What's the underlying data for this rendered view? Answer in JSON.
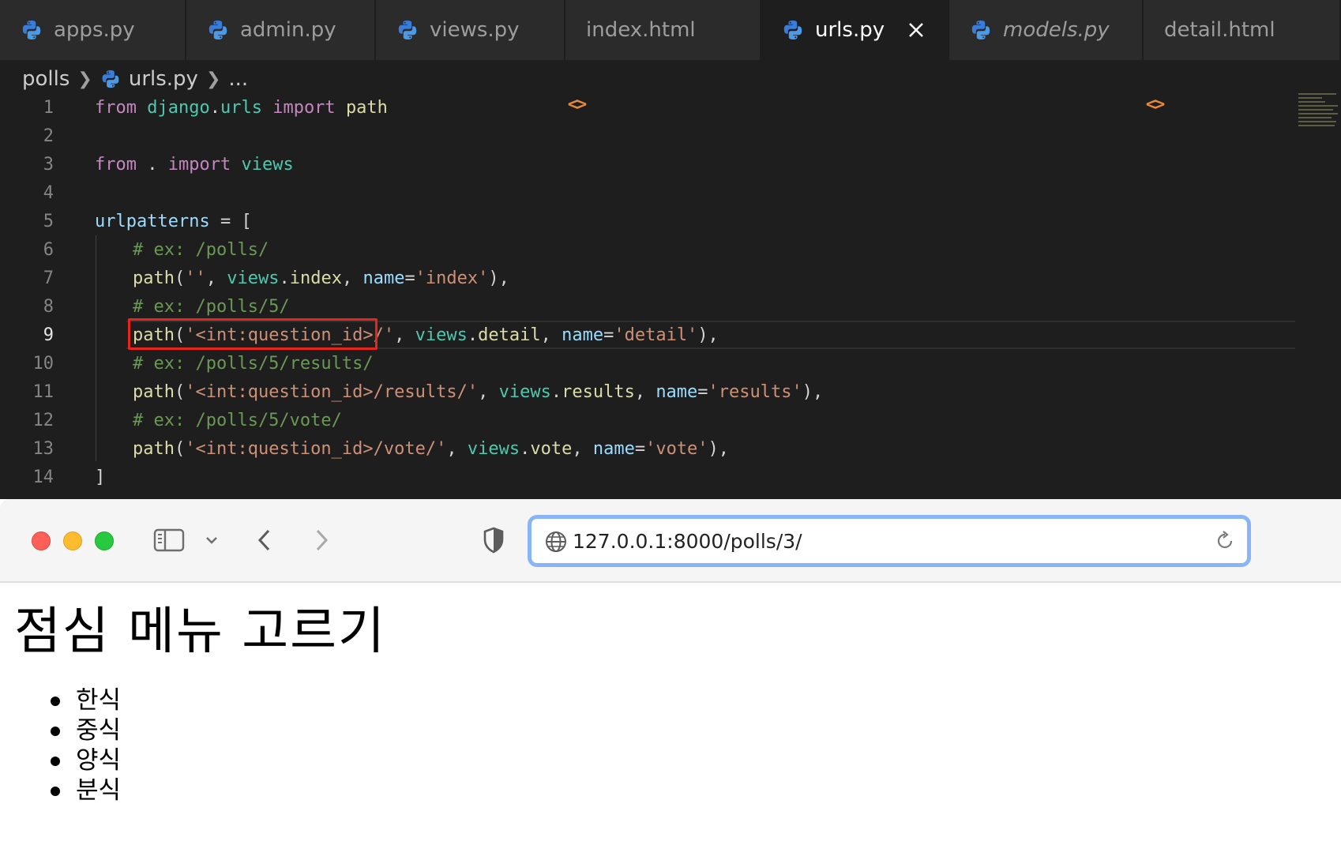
{
  "editor": {
    "tabs": [
      {
        "label": "apps.py",
        "type": "python",
        "active": false,
        "italic": false
      },
      {
        "label": "admin.py",
        "type": "python",
        "active": false,
        "italic": false
      },
      {
        "label": "views.py",
        "type": "python",
        "active": false,
        "italic": false
      },
      {
        "label": "index.html",
        "type": "html",
        "active": false,
        "italic": false
      },
      {
        "label": "urls.py",
        "type": "python",
        "active": true,
        "italic": false
      },
      {
        "label": "models.py",
        "type": "python",
        "active": false,
        "italic": true
      },
      {
        "label": "detail.html",
        "type": "html",
        "active": false,
        "italic": false
      }
    ],
    "breadcrumb": {
      "folder": "polls",
      "file": "urls.py",
      "more": "..."
    },
    "line_numbers": [
      "1",
      "2",
      "3",
      "4",
      "5",
      "6",
      "7",
      "8",
      "9",
      "10",
      "11",
      "12",
      "13",
      "14"
    ],
    "current_line": "9",
    "code": {
      "l1": {
        "from": "from",
        "module1": "django",
        "dot": ".",
        "module2": "urls",
        "import": "import",
        "name": "path"
      },
      "l3": {
        "from": "from",
        "dot": ".",
        "import": "import",
        "name": "views"
      },
      "l5": {
        "var": "urlpatterns",
        "rest": " = ["
      },
      "l6": "# ex: /polls/",
      "l7": {
        "fn": "path",
        "open": "(",
        "str": "''",
        "comma": ", ",
        "mod": "views",
        "dot": ".",
        "attr": "index",
        "comma2": ", ",
        "kw": "name",
        "eq": "=",
        "str2": "'index'",
        "close": "),"
      },
      "l8": "# ex: /polls/5/",
      "l9": {
        "fn": "path",
        "open": "(",
        "str": "'<int:question_id>/'",
        "comma": ", ",
        "mod": "views",
        "dot": ".",
        "attr": "detail",
        "comma2": ", ",
        "kw": "name",
        "eq": "=",
        "str2": "'detail'",
        "close": "),"
      },
      "l10": "# ex: /polls/5/results/",
      "l11": {
        "fn": "path",
        "open": "(",
        "str": "'<int:question_id>/results/'",
        "comma": ", ",
        "mod": "views",
        "dot": ".",
        "attr": "results",
        "comma2": ", ",
        "kw": "name",
        "eq": "=",
        "str2": "'results'",
        "close": "),"
      },
      "l12": "# ex: /polls/5/vote/",
      "l13": {
        "fn": "path",
        "open": "(",
        "str": "'<int:question_id>/vote/'",
        "comma": ", ",
        "mod": "views",
        "dot": ".",
        "attr": "vote",
        "comma2": ", ",
        "kw": "name",
        "eq": "=",
        "str2": "'vote'",
        "close": "),"
      },
      "l14": "]"
    },
    "highlight_color": "#e8251b"
  },
  "browser": {
    "url": "127.0.0.1:8000/polls/3/",
    "page": {
      "heading": "점심 메뉴 고르기",
      "choices": [
        "한식",
        "중식",
        "양식",
        "분식"
      ]
    },
    "url_focus_color": "#8ab4f8"
  },
  "icons": {
    "python_tab": "python-icon",
    "html_tab": "code-brackets-icon",
    "close": "close-icon",
    "sidebar": "sidebar-icon",
    "chevron_down": "chevron-down-icon",
    "back": "back-icon",
    "forward": "forward-icon",
    "shield": "shield-icon",
    "globe": "globe-icon",
    "reload": "reload-icon"
  }
}
